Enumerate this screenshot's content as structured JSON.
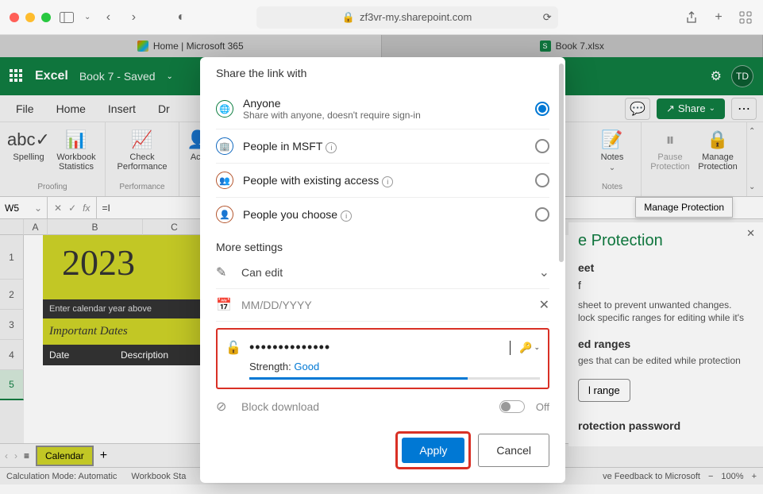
{
  "browser": {
    "url": "zf3vr-my.sharepoint.com",
    "tabs": [
      {
        "label": "Home | Microsoft 365"
      },
      {
        "label": "Book 7.xlsx"
      }
    ]
  },
  "excel": {
    "app": "Excel",
    "doc": "Book 7 - Saved",
    "avatar": "TD",
    "share": "Share",
    "ribbon_tabs": [
      "File",
      "Home",
      "Insert",
      "Dr"
    ],
    "ribbon": {
      "proofing": {
        "label": "Proofing",
        "items": [
          {
            "label": "Spelling"
          },
          {
            "label": "Workbook Statistics"
          }
        ]
      },
      "performance": {
        "label": "Performance",
        "items": [
          {
            "label": "Check Performance"
          }
        ]
      },
      "acc": {
        "items": [
          {
            "label": "Acc"
          }
        ]
      },
      "notes": {
        "label": "Notes",
        "items": [
          {
            "label": "Notes"
          }
        ]
      },
      "protection": {
        "items": [
          {
            "label": "Pause Protection"
          },
          {
            "label": "Manage Protection"
          }
        ]
      }
    },
    "tooltip": "Manage Protection",
    "name_box": "W5",
    "formula": "=I",
    "calendar": {
      "year": "2023",
      "enter_hint": "Enter calendar year above",
      "section": "Important Dates",
      "col1": "Date",
      "col2": "Description"
    },
    "sheet_tab": "Calendar",
    "status": {
      "calc": "Calculation Mode: Automatic",
      "stats": "Workbook Sta",
      "feedback": "ve Feedback to Microsoft",
      "zoom": "100%"
    }
  },
  "side_pane": {
    "title": "e Protection",
    "line1": "eet",
    "line2": "f",
    "desc1": "sheet to prevent unwanted changes.",
    "desc2": "lock specific ranges for editing while it's",
    "ranges_title": "ed ranges",
    "ranges_desc": "ges that can be edited while protection",
    "btn": "l range",
    "pw_title": "rotection password"
  },
  "dialog": {
    "title": "Share the link with",
    "options": [
      {
        "label": "Anyone",
        "sub": "Share with anyone, doesn't require sign-in",
        "checked": true
      },
      {
        "label": "People in MSFT",
        "checked": false
      },
      {
        "label": "People with existing access",
        "checked": false
      },
      {
        "label": "People you choose",
        "checked": false
      }
    ],
    "more": "More settings",
    "can_edit": "Can edit",
    "date_placeholder": "MM/DD/YYYY",
    "password_value": "••••••••••••••",
    "strength_label": "Strength:",
    "strength_value": "Good",
    "block_download": "Block download",
    "toggle_state": "Off",
    "apply": "Apply",
    "cancel": "Cancel"
  }
}
